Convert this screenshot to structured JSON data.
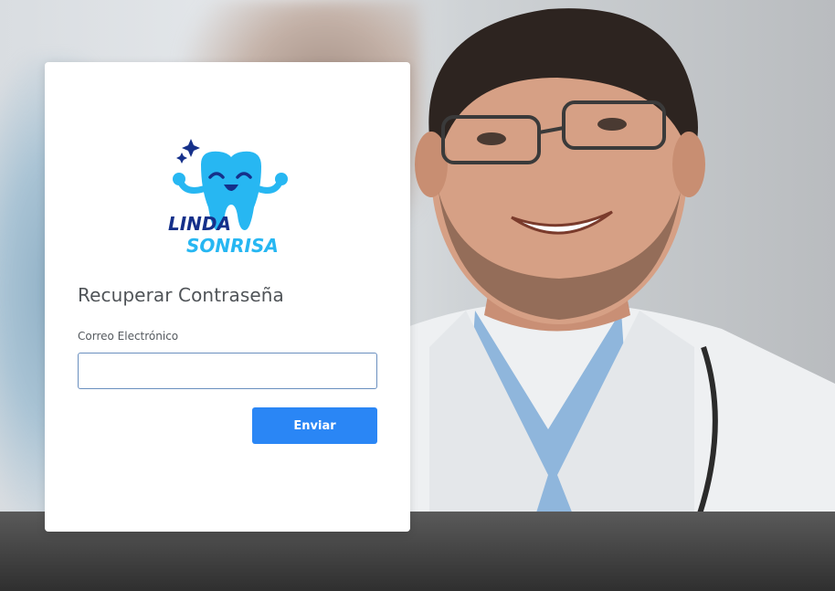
{
  "brand": {
    "line1": "LINDA",
    "line2": "SONRISA"
  },
  "form": {
    "title": "Recuperar Contraseña",
    "email_label": "Correo Electrónico",
    "email_value": "",
    "submit_label": "Enviar"
  },
  "colors": {
    "accent": "#2a86f5",
    "logo_light": "#27b7f2",
    "logo_dark": "#15308a",
    "card_bg": "#ffffff"
  }
}
